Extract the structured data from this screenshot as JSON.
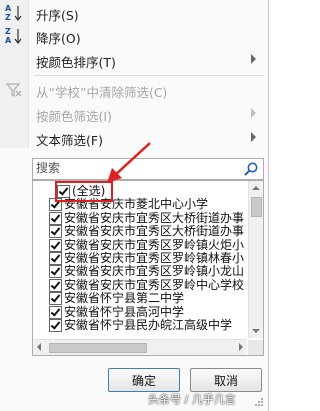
{
  "menu": {
    "sort_asc": "升序(S)",
    "sort_desc": "降序(O)",
    "sort_by_color": "按颜色排序(T)",
    "clear_filter": "从“学校”中清除筛选(C)",
    "filter_by_color": "按颜色筛选(I)",
    "text_filters": "文本筛选(F)"
  },
  "search": {
    "placeholder": "搜索"
  },
  "list": {
    "items": [
      {
        "label": "(全选)",
        "checked": true
      },
      {
        "label": "安徽省安庆市菱北中心小学",
        "checked": true
      },
      {
        "label": "安徽省安庆市宜秀区大桥街道办事",
        "checked": true
      },
      {
        "label": "安徽省安庆市宜秀区大桥街道办事",
        "checked": true
      },
      {
        "label": "安徽省安庆市宜秀区罗岭镇火炬小",
        "checked": true
      },
      {
        "label": "安徽省安庆市宜秀区罗岭镇林春小",
        "checked": true
      },
      {
        "label": "安徽省安庆市宜秀区罗岭镇小龙山",
        "checked": true
      },
      {
        "label": "安徽省安庆市宜秀区罗岭中心学校",
        "checked": true
      },
      {
        "label": "安徽省怀宁县第二中学",
        "checked": true
      },
      {
        "label": "安徽省怀宁县高河中学",
        "checked": true
      },
      {
        "label": "安徽省怀宁县民办皖江高级中学",
        "checked": true
      }
    ]
  },
  "buttons": {
    "ok": "确定",
    "cancel": "取消"
  },
  "watermark": "头条号 / 几乎几言",
  "colors": {
    "highlight": "#e02020",
    "accent": "#1f4e9a"
  }
}
